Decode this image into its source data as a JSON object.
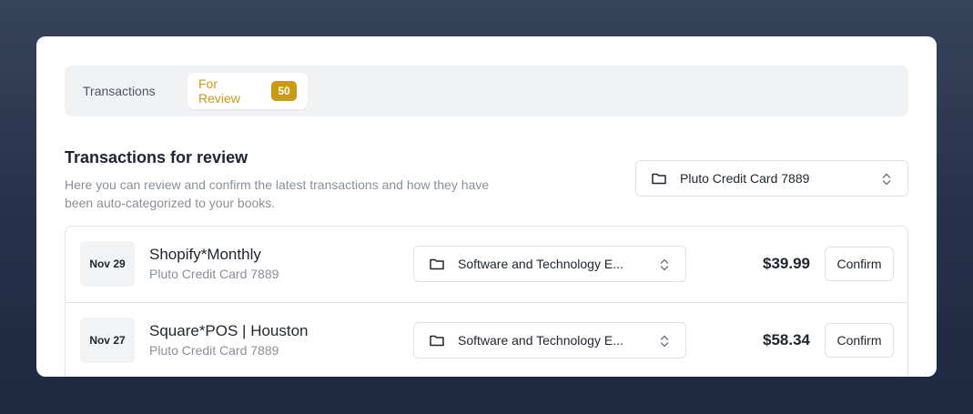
{
  "tabs": [
    {
      "label": "Transactions",
      "active": false
    },
    {
      "label": "For Review",
      "active": true,
      "badge": "50"
    }
  ],
  "colors": {
    "accent": "#c99a12",
    "background": "#25304a"
  },
  "section": {
    "title": "Transactions for review",
    "description": "Here you can review and confirm the latest transactions and how they have been auto-categorized to your books."
  },
  "account_filter": {
    "label": "Pluto Credit Card 7889",
    "icon": "folder-icon"
  },
  "transactions": [
    {
      "date": "Nov 29",
      "merchant": "Shopify*Monthly",
      "account": "Pluto Credit Card 7889",
      "category": "Software and Technology E...",
      "amount": "$39.99",
      "action": "Confirm"
    },
    {
      "date": "Nov 27",
      "merchant": "Square*POS | Houston",
      "account": "Pluto Credit Card 7889",
      "category": "Software and Technology E...",
      "amount": "$58.34",
      "action": "Confirm"
    }
  ]
}
